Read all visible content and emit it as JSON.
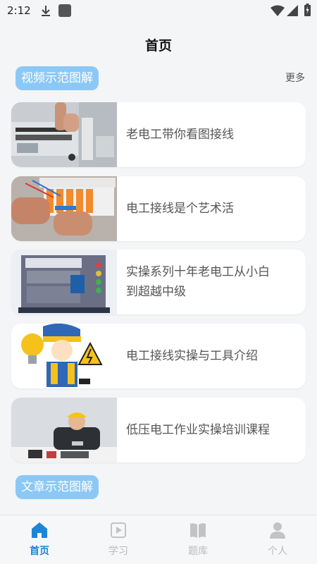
{
  "status": {
    "time": "2:12"
  },
  "header": {
    "title": "首页"
  },
  "sections": {
    "video": {
      "label": "视频示范图解",
      "more": "更多"
    },
    "article": {
      "label": "文章示范图解"
    }
  },
  "videos": [
    {
      "title": "老电工带你看图接线"
    },
    {
      "title": "电工接线是个艺术活"
    },
    {
      "title": "实操系列十年老电工从小白到超越中级"
    },
    {
      "title": "电工接线实操与工具介绍"
    },
    {
      "title": "低压电工作业实操培训课程"
    }
  ],
  "tabs": [
    {
      "label": "首页",
      "icon": "home-icon",
      "active": true
    },
    {
      "label": "学习",
      "icon": "video-play-icon",
      "active": false
    },
    {
      "label": "题库",
      "icon": "book-icon",
      "active": false
    },
    {
      "label": "个人",
      "icon": "person-icon",
      "active": false
    }
  ],
  "colors": {
    "accent": "#1a86d8",
    "chip": "#8cc8f5",
    "background": "#f4f5f7"
  }
}
